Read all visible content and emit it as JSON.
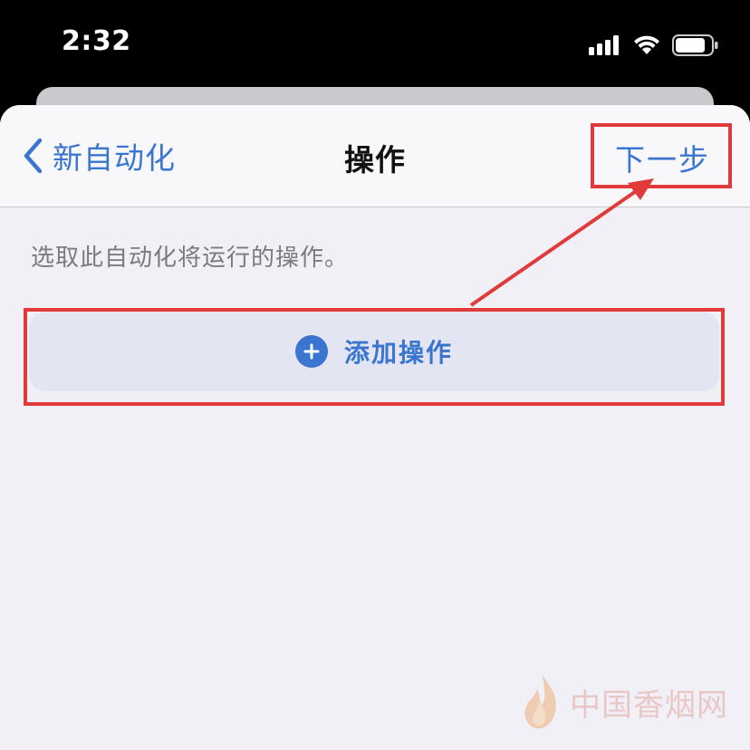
{
  "status_bar": {
    "time": "2:32"
  },
  "nav": {
    "back_label": "新自动化",
    "title": "操作",
    "next_label": "下一步"
  },
  "content": {
    "description": "选取此自动化将运行的操作。",
    "add_action_label": "添加操作"
  },
  "watermark": {
    "text": "中国香烟网"
  },
  "colors": {
    "accent": "#3a76d0",
    "sheet_bg": "#f1f0f6",
    "annotation": "#e03a3a"
  }
}
